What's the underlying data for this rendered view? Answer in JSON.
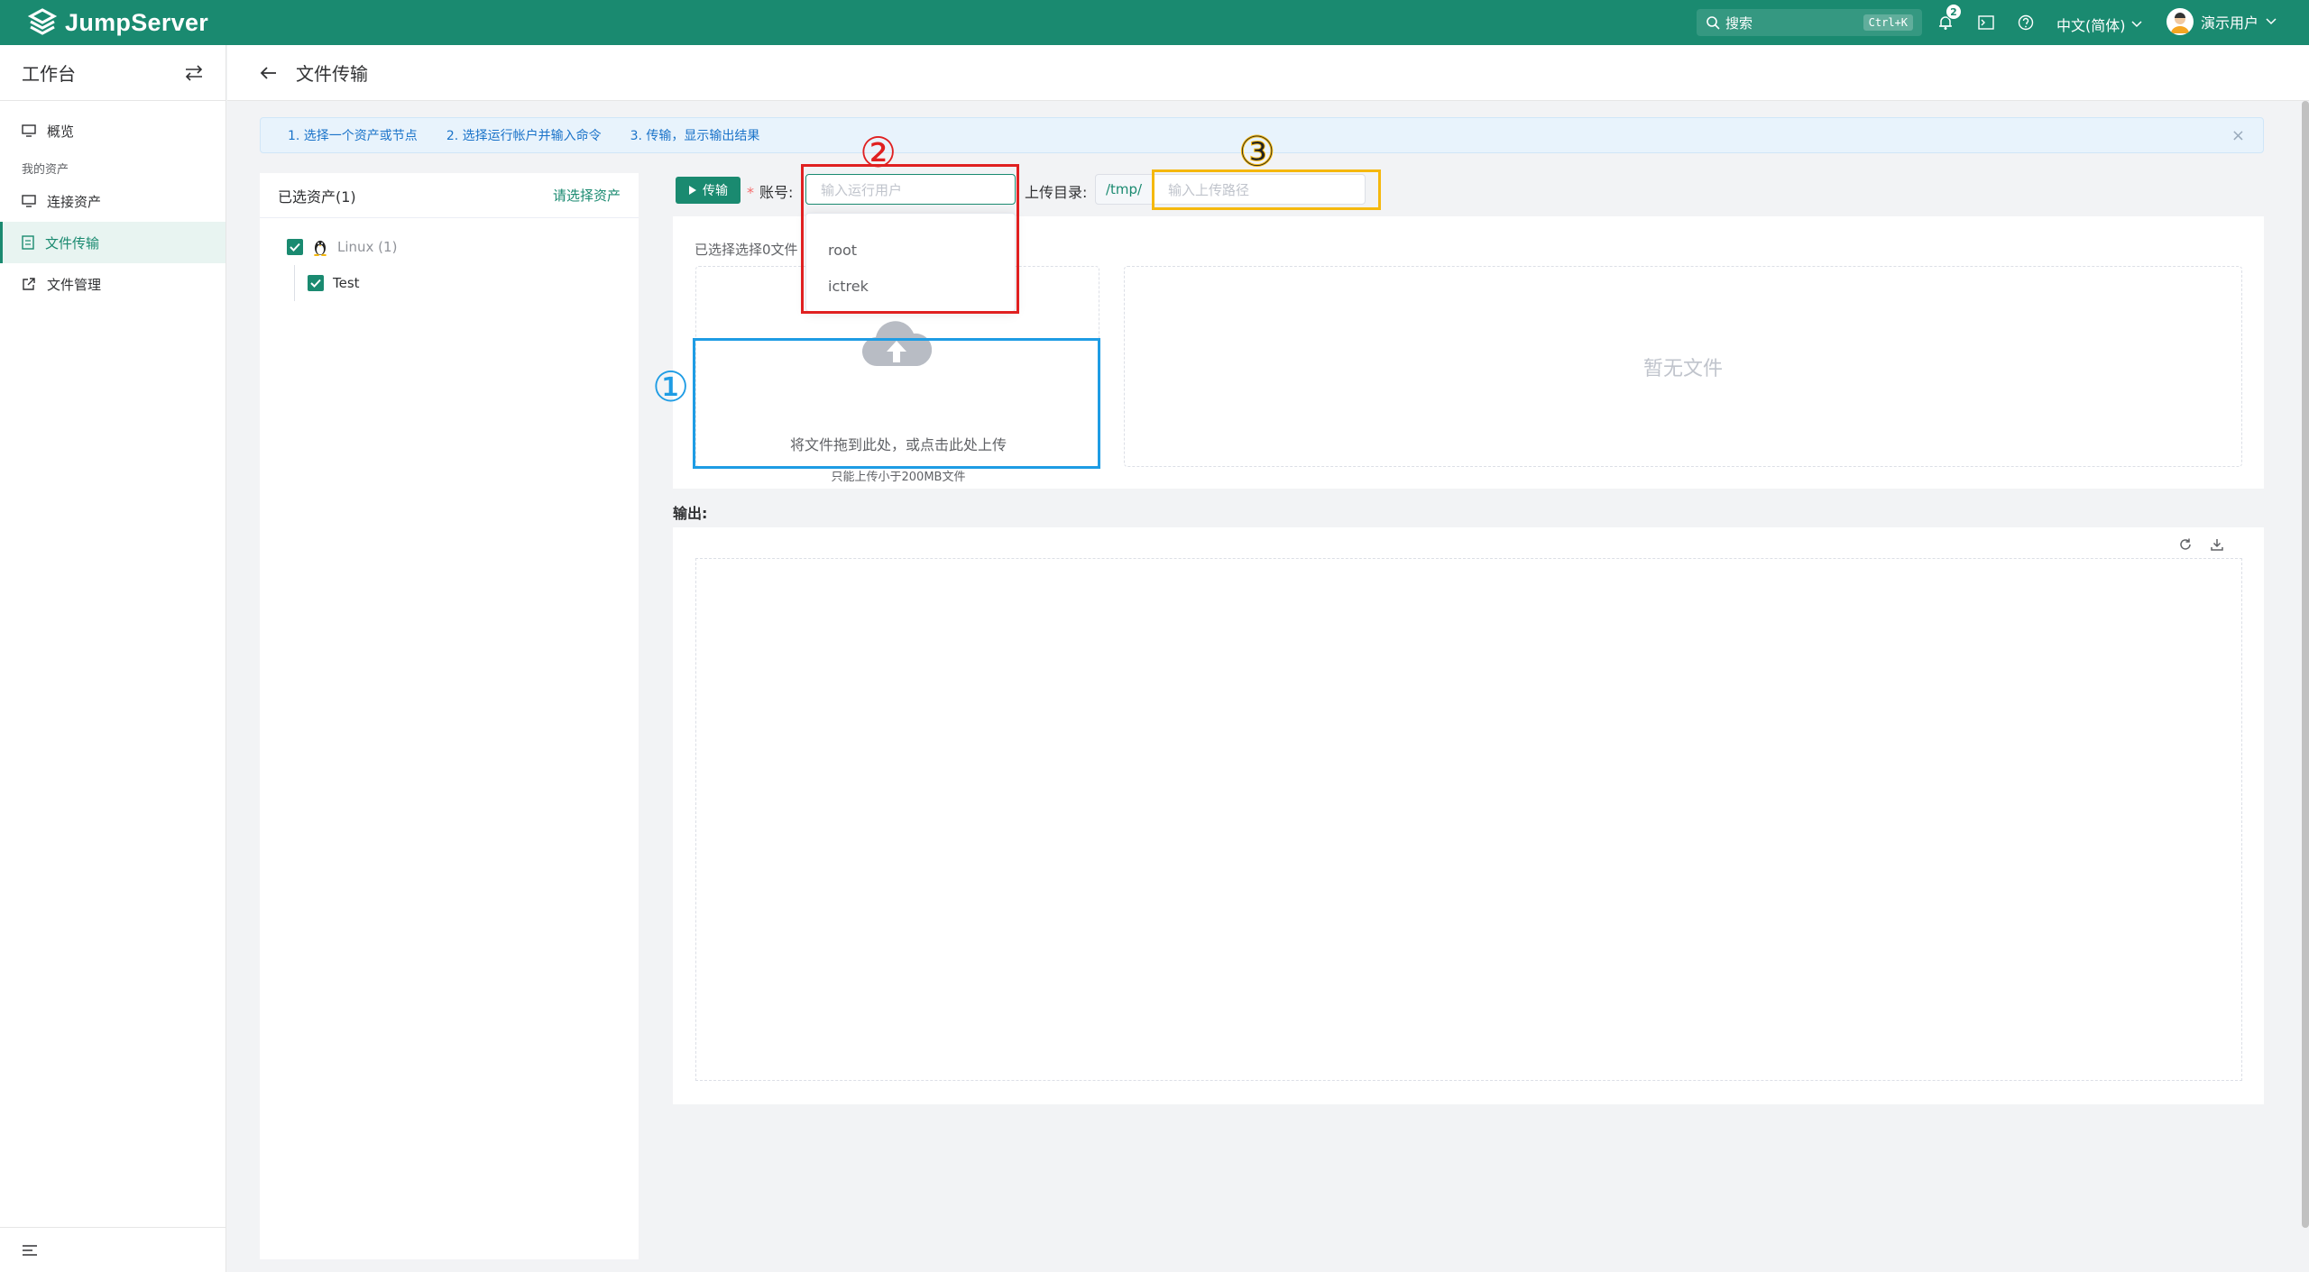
{
  "brand": {
    "name": "JumpServer",
    "accent": "#1a8a70"
  },
  "topbar": {
    "search_placeholder": "搜索",
    "search_shortcut": "Ctrl+K",
    "notification_count": "2",
    "language": "中文(简体)",
    "user_name": "演示用户"
  },
  "sidebar": {
    "title": "工作台",
    "items": [
      {
        "label": "概览",
        "icon": "monitor-icon"
      },
      {
        "label": "连接资产",
        "icon": "monitor-icon"
      },
      {
        "label": "文件传输",
        "icon": "document-icon",
        "active": true
      },
      {
        "label": "文件管理",
        "icon": "external-link-icon"
      }
    ],
    "group_label": "我的资产"
  },
  "page": {
    "title": "文件传输"
  },
  "steps": [
    "1. 选择一个资产或节点",
    "2. 选择运行帐户并输入命令",
    "3. 传输，显示输出结果"
  ],
  "asset_panel": {
    "title": "已选资产(1)",
    "select_link": "请选择资产",
    "tree": {
      "node_label": "Linux (1)",
      "child_label": "Test"
    }
  },
  "toolbar": {
    "transfer_button": "传输",
    "account_label": "账号:",
    "account_placeholder": "输入运行用户",
    "account_options": [
      "root",
      "ictrek"
    ],
    "upload_dir_label": "上传目录:",
    "upload_dir_prefix": "/tmp/",
    "upload_path_placeholder": "输入上传路径"
  },
  "upload": {
    "selected_count": "已选择选择0文件",
    "drop_text": "将文件拖到此处，或点击此处上传",
    "drop_tip": "只能上传小于200MB文件",
    "empty_text": "暂无文件"
  },
  "output": {
    "label": "输出:"
  },
  "annotations": {
    "step1": "①",
    "step2": "②",
    "step3": "③"
  },
  "colors": {
    "red": "#e02020",
    "yellow": "#f5b80e",
    "blue": "#1e9ce4"
  }
}
